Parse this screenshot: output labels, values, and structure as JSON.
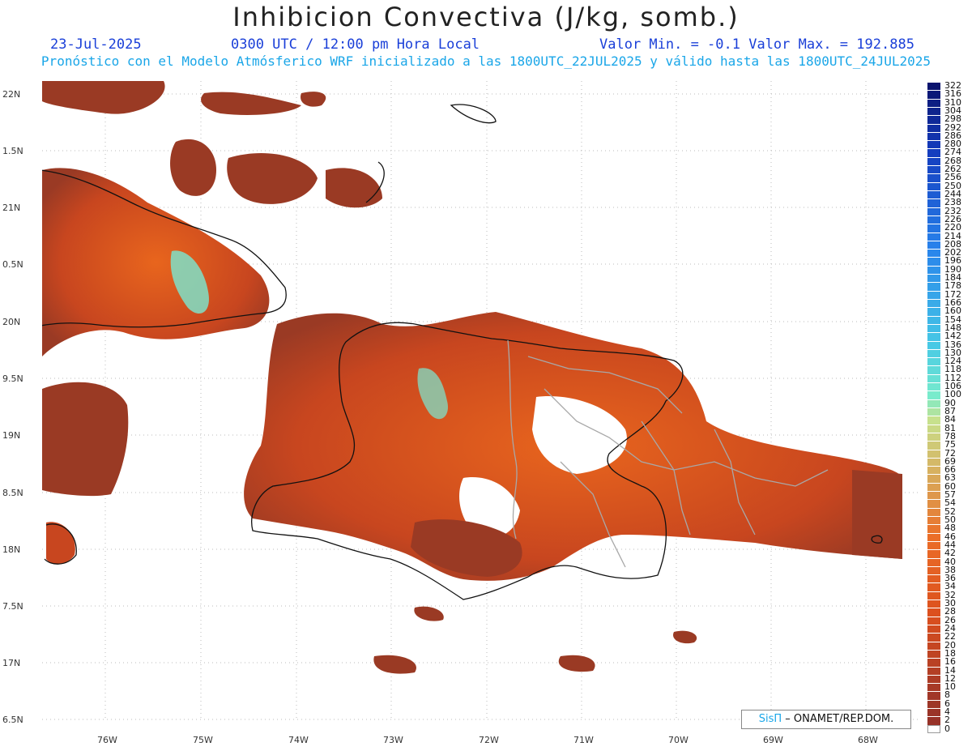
{
  "title": "Inhibicion Convectiva (J/kg, somb.)",
  "header": {
    "date": "23-Jul-2025",
    "time": "0300 UTC / 12:00 pm Hora Local",
    "min_max": "Valor Min. = -0.1  Valor Max. = 192.885",
    "subtitle": "Pronóstico con el Modelo Atmósferico WRF inicializado a las 1800UTC_22JUL2025 y válido hasta las  1800UTC_24JUL2025"
  },
  "axes": {
    "lat_labels": [
      "22N",
      "1.5N",
      "21N",
      "0.5N",
      "20N",
      "9.5N",
      "19N",
      "8.5N",
      "18N",
      "7.5N",
      "17N",
      "6.5N"
    ],
    "lon_labels": [
      "76W",
      "75W",
      "74W",
      "73W",
      "72W",
      "71W",
      "70W",
      "69W",
      "68W"
    ]
  },
  "colorbar": {
    "labels": [
      "322",
      "316",
      "310",
      "304",
      "298",
      "292",
      "286",
      "280",
      "274",
      "268",
      "262",
      "256",
      "250",
      "244",
      "238",
      "232",
      "226",
      "220",
      "214",
      "208",
      "202",
      "196",
      "190",
      "184",
      "178",
      "172",
      "166",
      "160",
      "154",
      "148",
      "142",
      "136",
      "130",
      "124",
      "118",
      "112",
      "106",
      "100",
      "90",
      "87",
      "84",
      "81",
      "78",
      "75",
      "72",
      "69",
      "66",
      "63",
      "60",
      "57",
      "54",
      "52",
      "50",
      "48",
      "46",
      "44",
      "42",
      "40",
      "38",
      "36",
      "34",
      "32",
      "30",
      "28",
      "26",
      "24",
      "22",
      "20",
      "18",
      "16",
      "14",
      "12",
      "10",
      "8",
      "6",
      "4",
      "2",
      "0"
    ]
  },
  "credit": {
    "brand": "SisΠ",
    "text": "– ONAMET/REP.DOM."
  },
  "colors": {
    "field_low": "#9a3a24",
    "field_mid": "#e0561f",
    "field_high": "#7fe0c8",
    "header_blue": "#1a3fd8",
    "subtitle_cyan": "#1aa6e8"
  }
}
